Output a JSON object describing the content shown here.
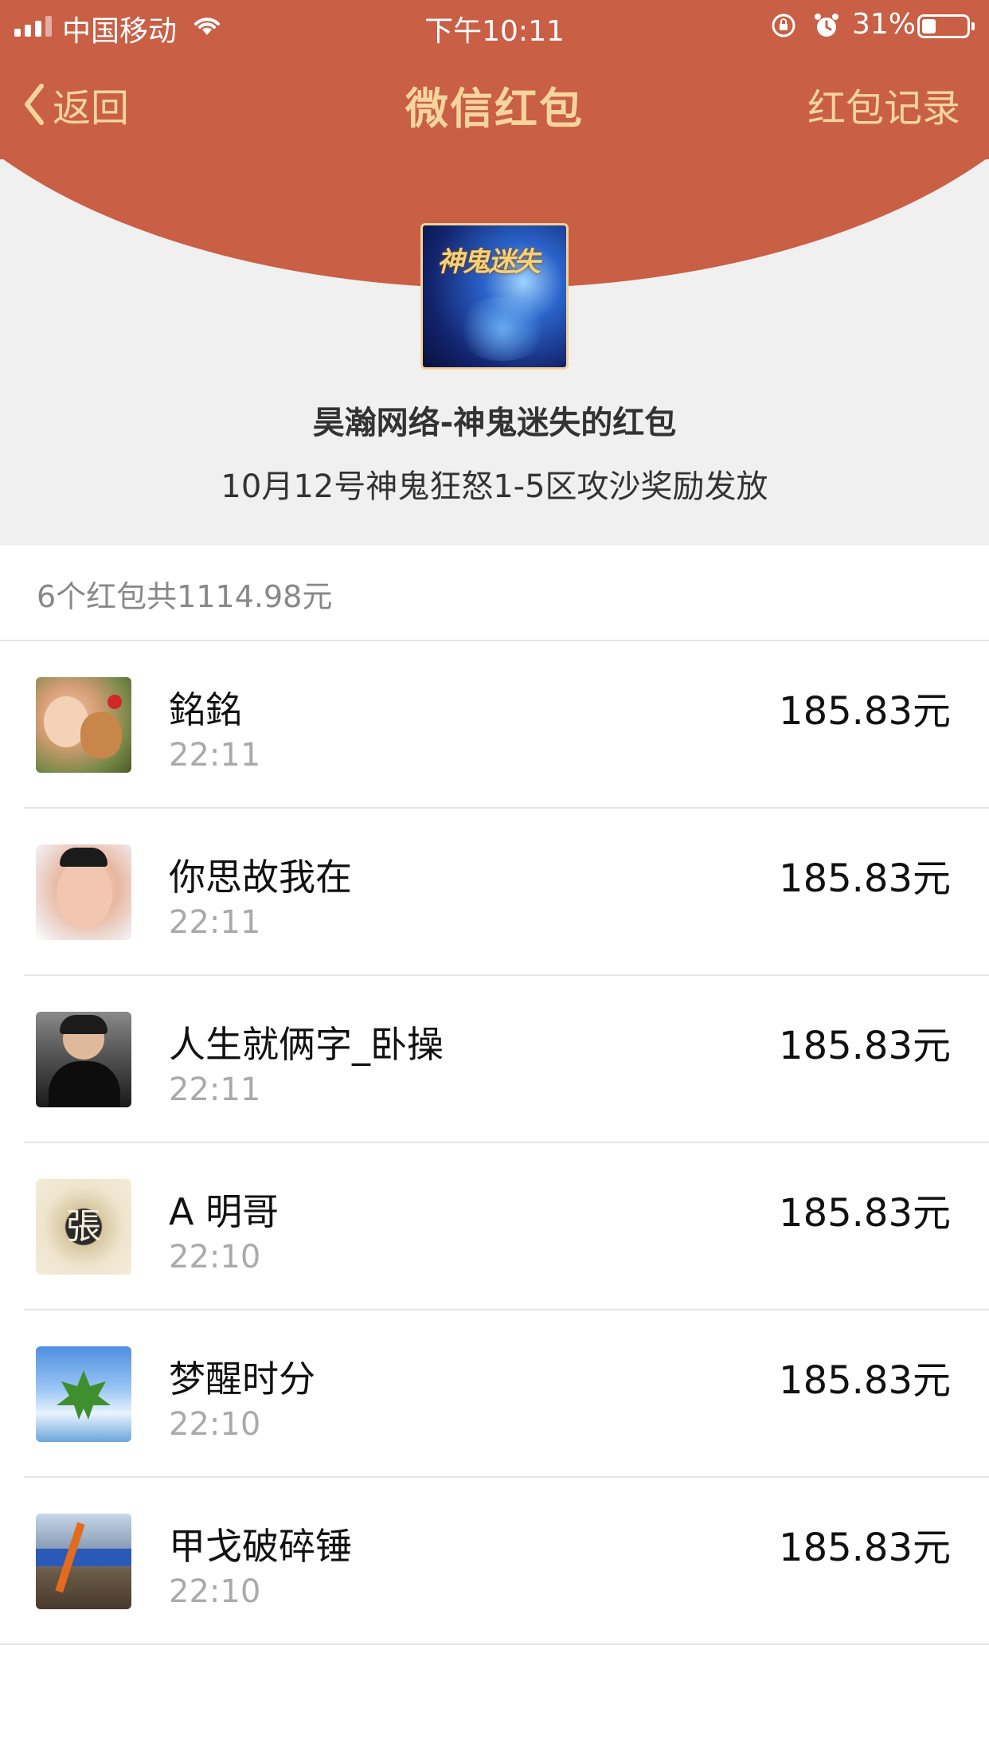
{
  "status_bar": {
    "carrier": "中国移动",
    "time": "下午10:11",
    "battery_percent": "31%",
    "battery_level": 0.31
  },
  "nav": {
    "back_label": "返回",
    "title": "微信红包",
    "record_label": "红包记录"
  },
  "colors": {
    "header_red": "#c95f45",
    "gold_text": "#f6d59c",
    "page_bg": "#f0f0f0"
  },
  "sender": {
    "avatar_text": "神鬼迷失",
    "name": "昊瀚网络-神鬼迷失的红包",
    "wish": "10月12号神鬼狂怒1-5区攻沙奖励发放"
  },
  "summary": "6个红包共1114.98元",
  "recipients": [
    {
      "name": "銘銘",
      "time": "22:11",
      "amount": "185.83元",
      "avatar": "child-with-puppy-avatar"
    },
    {
      "name": "你思故我在",
      "time": "22:11",
      "amount": "185.83元",
      "avatar": "baby-avatar"
    },
    {
      "name": "人生就俩字_卧操",
      "time": "22:11",
      "amount": "185.83元",
      "avatar": "man-in-black-avatar"
    },
    {
      "name": "A 明哥",
      "time": "22:10",
      "amount": "185.83元",
      "avatar": "zhang-seal-avatar",
      "avatar_text": "張"
    },
    {
      "name": "梦醒时分",
      "time": "22:10",
      "amount": "185.83元",
      "avatar": "maple-leaf-sky-avatar"
    },
    {
      "name": "甲戈破碎锤",
      "time": "22:10",
      "amount": "185.83元",
      "avatar": "excavator-site-avatar"
    }
  ]
}
